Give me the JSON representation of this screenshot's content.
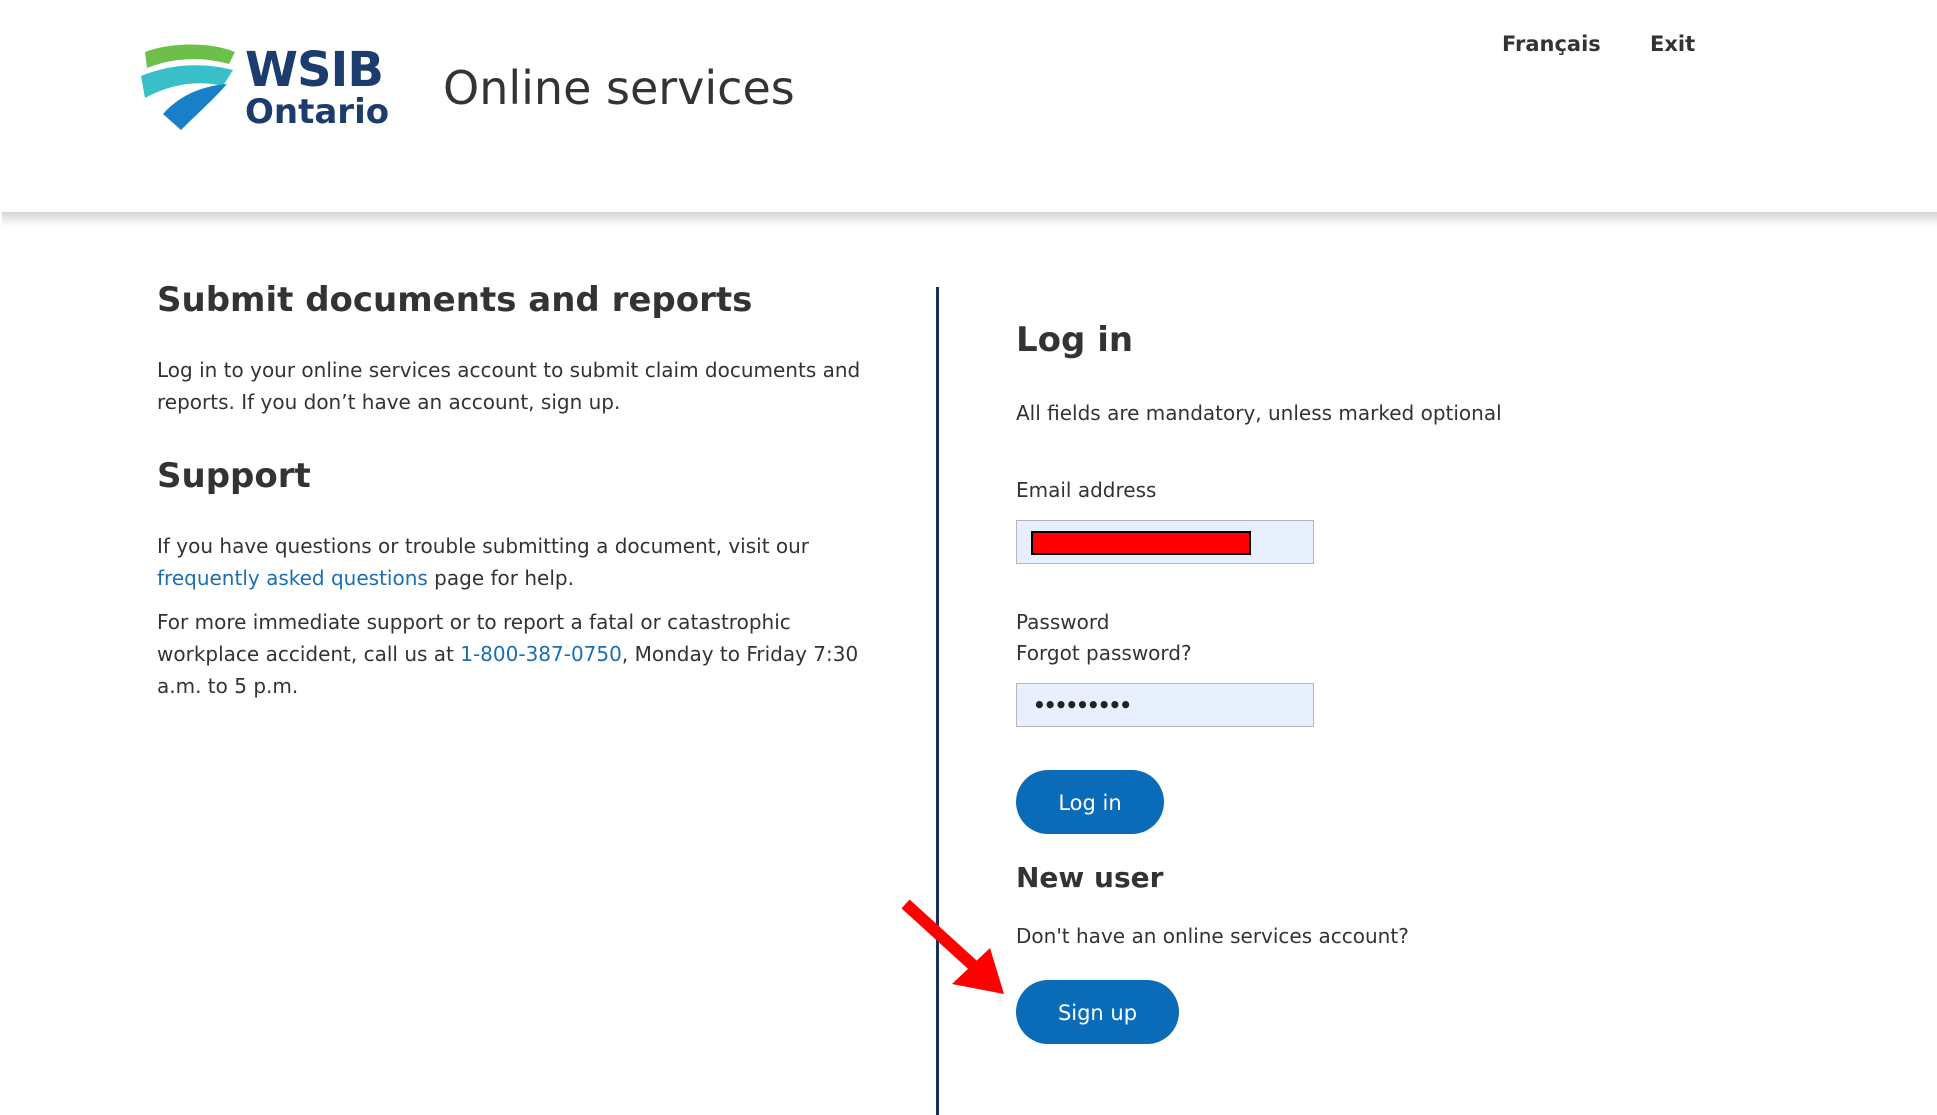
{
  "header": {
    "logo_line1": "WSIB",
    "logo_line2": "Ontario",
    "title": "Online services",
    "lang_link": "Français",
    "exit_link": "Exit"
  },
  "left": {
    "submit_heading": "Submit documents and reports",
    "submit_text": "Log in to your online services account to submit claim documents and reports. If you don’t have an account, sign up.",
    "support_heading": "Support",
    "support_text_before": "If you have questions or trouble submitting a document, visit our",
    "faq_link": "frequently asked questions",
    "support_text_after": "page for help.",
    "immediate_text_before": "For more immediate support or to report a fatal or catastrophic workplace accident, call us at",
    "phone_link": "1-800-387-0750",
    "immediate_text_after": ", Monday to Friday 7:30 a.m. to 5 p.m."
  },
  "login": {
    "heading": "Log in",
    "mandatory_note": "All fields are mandatory, unless marked optional",
    "email_label": "Email address",
    "password_label": "Password",
    "forgot_link": "Forgot password?",
    "password_value": "•••••••••",
    "login_button": "Log in"
  },
  "new_user": {
    "heading": "New user",
    "prompt": "Don't have an online services account?",
    "signup_button": "Sign up"
  },
  "colors": {
    "brand_navy": "#1c3c6e",
    "button_blue": "#0a6cb8",
    "link_blue": "#1a6eb5",
    "input_bg": "#e8f0fe",
    "annotation_red": "#ff0000"
  }
}
